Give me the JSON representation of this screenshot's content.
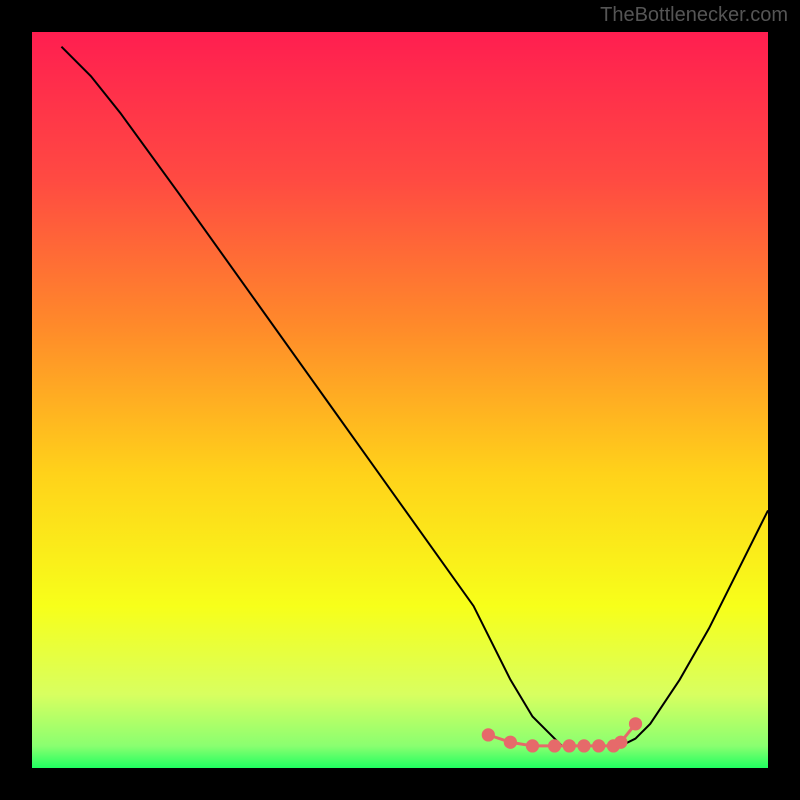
{
  "watermark": "TheBottlenecker.com",
  "chart_data": {
    "type": "line",
    "title": "",
    "xlabel": "",
    "ylabel": "",
    "x_range": [
      0,
      100
    ],
    "y_range": [
      0,
      100
    ],
    "series": [
      {
        "name": "curve",
        "x": [
          4,
          8,
          12,
          20,
          30,
          40,
          50,
          60,
          62,
          65,
          68,
          72,
          76,
          80,
          82,
          84,
          88,
          92,
          96,
          100
        ],
        "y": [
          98,
          94,
          89,
          78,
          64,
          50,
          36,
          22,
          18,
          12,
          7,
          3,
          3,
          3,
          4,
          6,
          12,
          19,
          27,
          35
        ]
      }
    ],
    "highlight_points": {
      "x": [
        62,
        65,
        68,
        71,
        73,
        75,
        77,
        79,
        80,
        82
      ],
      "y": [
        4.5,
        3.5,
        3,
        3,
        3,
        3,
        3,
        3,
        3.5,
        6
      ]
    },
    "background_gradient": {
      "stops": [
        {
          "offset": 0.0,
          "color": "#ff1e50"
        },
        {
          "offset": 0.2,
          "color": "#ff4a42"
        },
        {
          "offset": 0.4,
          "color": "#ff8a2a"
        },
        {
          "offset": 0.6,
          "color": "#ffd21a"
        },
        {
          "offset": 0.78,
          "color": "#f7ff1a"
        },
        {
          "offset": 0.9,
          "color": "#d8ff60"
        },
        {
          "offset": 0.97,
          "color": "#8aff70"
        },
        {
          "offset": 1.0,
          "color": "#20ff60"
        }
      ]
    }
  }
}
